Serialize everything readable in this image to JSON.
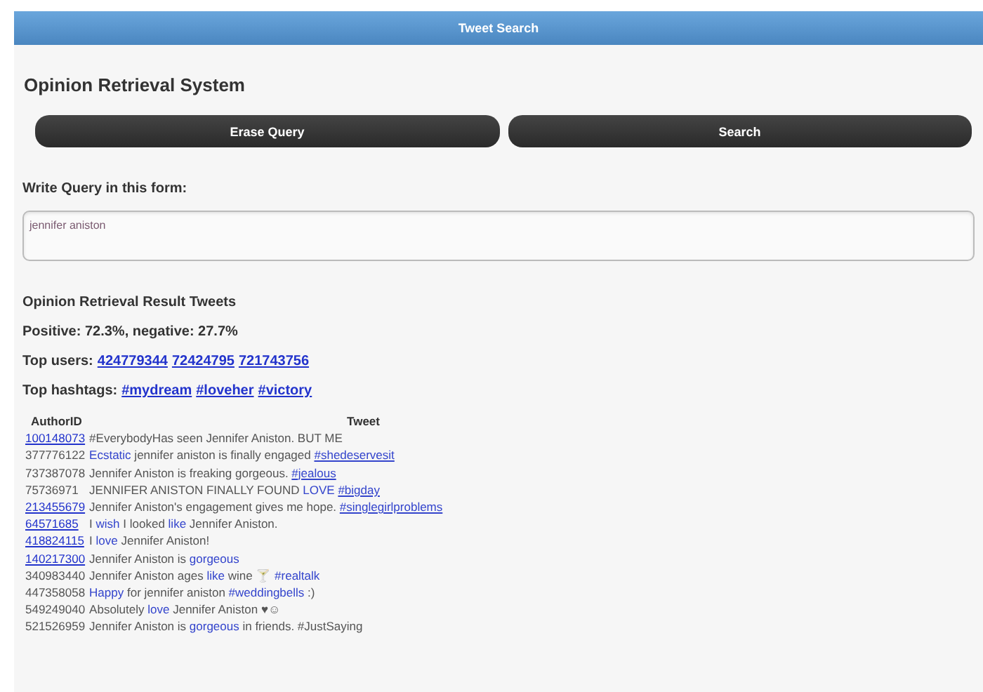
{
  "header": {
    "title": "Tweet Search"
  },
  "heading": "Opinion Retrieval System",
  "buttons": [
    "Erase Query",
    "Search"
  ],
  "query": {
    "label": "Write Query in this form:",
    "value": "jennifer aniston"
  },
  "results": {
    "title": "Opinion Retrieval Result Tweets",
    "sentiment": "Positive: 72.3%, negative: 27.7%",
    "top_users": {
      "label": "Top users:",
      "links": [
        "424779344",
        "72424795",
        "721743756"
      ]
    },
    "top_hashtags": {
      "label": "Top hashtags:",
      "links": [
        "#mydream",
        "#loveher",
        "#victory"
      ]
    }
  },
  "table": {
    "columns": [
      "AuthorID",
      "Tweet"
    ],
    "rows": [
      {
        "author": "100148073",
        "linked": true,
        "tweet": [
          {
            "kind": "text",
            "text": "#EverybodyHas seen Jennifer Aniston. BUT ME"
          }
        ]
      },
      {
        "author": "377776122",
        "linked": false,
        "tweet": [
          {
            "kind": "word",
            "text": "Ecstatic"
          },
          {
            "kind": "text",
            "text": " jennifer aniston is finally engaged "
          },
          {
            "kind": "tag",
            "text": "#shedeservesit"
          }
        ]
      },
      {
        "author": "737387078",
        "linked": false,
        "tweet": [
          {
            "kind": "text",
            "text": "Jennifer Aniston is freaking gorgeous. "
          },
          {
            "kind": "tag",
            "text": "#jealous"
          }
        ]
      },
      {
        "author": "75736971",
        "linked": false,
        "tweet": [
          {
            "kind": "text",
            "text": "JENNIFER ANISTON FINALLY FOUND "
          },
          {
            "kind": "word",
            "text": "LOVE "
          },
          {
            "kind": "tag",
            "text": "#bigday"
          }
        ]
      },
      {
        "author": "213455679",
        "linked": true,
        "tweet": [
          {
            "kind": "text",
            "text": "Jennifer Aniston's engagement gives me hope. "
          },
          {
            "kind": "tag",
            "text": "#singlegirlproblems"
          }
        ]
      },
      {
        "author": "64571685",
        "linked": true,
        "tweet": [
          {
            "kind": "text",
            "text": "I "
          },
          {
            "kind": "word",
            "text": "wish"
          },
          {
            "kind": "text",
            "text": " I looked "
          },
          {
            "kind": "word",
            "text": "like"
          },
          {
            "kind": "text",
            "text": " Jennifer Aniston."
          }
        ]
      },
      {
        "author": "418824115",
        "linked": true,
        "tweet": [
          {
            "kind": "text",
            "text": "I "
          },
          {
            "kind": "word",
            "text": "love"
          },
          {
            "kind": "text",
            "text": " Jennifer Aniston!"
          }
        ]
      },
      {
        "author": "140217300",
        "linked": true,
        "tweet": [
          {
            "kind": "text",
            "text": "Jennifer Aniston is "
          },
          {
            "kind": "word",
            "text": "gorgeous"
          }
        ]
      },
      {
        "author": "340983440",
        "linked": false,
        "tweet": [
          {
            "kind": "text",
            "text": "Jennifer Aniston ages "
          },
          {
            "kind": "word",
            "text": "like"
          },
          {
            "kind": "text",
            "text": " wine 🍸 "
          },
          {
            "kind": "word",
            "text": "#realtalk"
          }
        ]
      },
      {
        "author": "447358058",
        "linked": false,
        "tweet": [
          {
            "kind": "word",
            "text": "Happy"
          },
          {
            "kind": "text",
            "text": " for jennifer aniston "
          },
          {
            "kind": "word",
            "text": "#weddingbells"
          },
          {
            "kind": "text",
            "text": " :)"
          }
        ]
      },
      {
        "author": "549249040",
        "linked": false,
        "tweet": [
          {
            "kind": "text",
            "text": "Absolutely "
          },
          {
            "kind": "word",
            "text": "love"
          },
          {
            "kind": "text",
            "text": " Jennifer Aniston ♥☺"
          }
        ]
      },
      {
        "author": "521526959",
        "linked": false,
        "tweet": [
          {
            "kind": "text",
            "text": "Jennifer Aniston is "
          },
          {
            "kind": "word",
            "text": "gorgeous"
          },
          {
            "kind": "text",
            "text": " in friends. #JustSaying"
          }
        ]
      }
    ]
  }
}
